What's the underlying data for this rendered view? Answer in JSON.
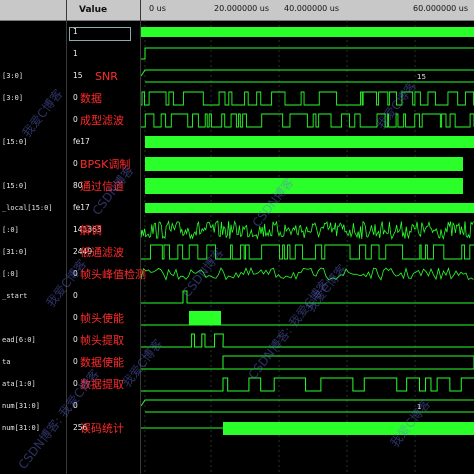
{
  "headers": {
    "value": "Value"
  },
  "ruler": [
    "0 us",
    "20.000000 us",
    "40.000000 us",
    "60.000000 us"
  ],
  "signals": [
    {
      "name": "",
      "value": "1",
      "caption": ""
    },
    {
      "name": "",
      "value": "1",
      "caption": ""
    },
    {
      "name": "[3:0]",
      "value": "15",
      "caption": "SNR"
    },
    {
      "name": "[3:0]",
      "value": "0",
      "caption": "数据"
    },
    {
      "name": "",
      "value": "0",
      "caption": "成型滤波"
    },
    {
      "name": "[15:0]",
      "value": "fe17",
      "caption": ""
    },
    {
      "name": "",
      "value": "0",
      "caption": "BPSK调制"
    },
    {
      "name": "[15:0]",
      "value": "80",
      "caption": "通过信道"
    },
    {
      "name": "_local[15:0]",
      "value": "fe17",
      "caption": ""
    },
    {
      "name": "[:0]",
      "value": "141363",
      "caption": "解调"
    },
    {
      "name": "[31:0]",
      "value": "2449",
      "caption": "低通滤波"
    },
    {
      "name": "[:0]",
      "value": "0",
      "caption": "帧头峰值检测"
    },
    {
      "name": "_start",
      "value": "0",
      "caption": ""
    },
    {
      "name": "",
      "value": "0",
      "caption": "帧头使能"
    },
    {
      "name": "ead[6:0]",
      "value": "0",
      "caption": "帧头提取"
    },
    {
      "name": "ta",
      "value": "0",
      "caption": "数据使能"
    },
    {
      "name": "ata[1:0]",
      "value": "0",
      "caption": "数据提取"
    },
    {
      "name": "num[31:0]",
      "value": "0",
      "caption": ""
    },
    {
      "name": "num[31:0]",
      "value": "256",
      "caption": "误码统计"
    }
  ],
  "wave_labels": {
    "snr": "15",
    "count": "1"
  },
  "watermarks": [
    "我爱C博客",
    "CSDN博客",
    "CSDN博客: 我爱C博客"
  ],
  "colors": {
    "wave": "#2aff2a",
    "text": "#ff2a2a"
  }
}
